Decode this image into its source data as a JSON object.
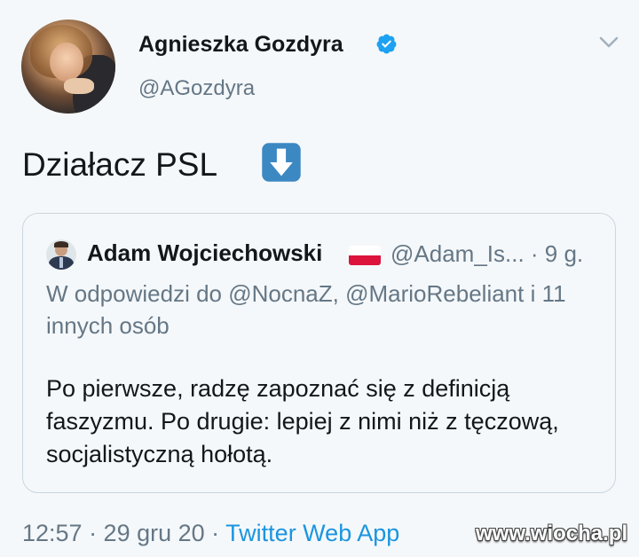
{
  "author": {
    "name": "Agnieszka Gozdyra",
    "handle": "@AGozdyra",
    "verified_icon": "verified-badge-icon",
    "menu_icon": "chevron-down-icon"
  },
  "tweet": {
    "text": "Działacz PSL",
    "emoji": "down-arrow-emoji"
  },
  "quoted_tweet": {
    "name": "Adam Wojciechowski",
    "flag": "poland-flag-emoji",
    "meta": "@Adam_Is... · 9 g.",
    "reply_context": "W odpowiedzi do @NocnaZ, @MarioRebeliant i 11 innych osób",
    "body": "Po pierwsze, radzę zapoznać się z definicją faszyzmu. Po drugie: lepiej z nimi niż z tęczową, socjalistyczną hołotą."
  },
  "footer": {
    "time_date": "12:57 · 29 gru 20 · ",
    "source": "Twitter Web App"
  },
  "watermark": "www.wiocha.pl",
  "colors": {
    "background": "#f5f8fa",
    "text": "#14171a",
    "secondary": "#657786",
    "link": "#1b95e0",
    "verified": "#1da1f2",
    "emoji_blue": "#3b88c3"
  }
}
